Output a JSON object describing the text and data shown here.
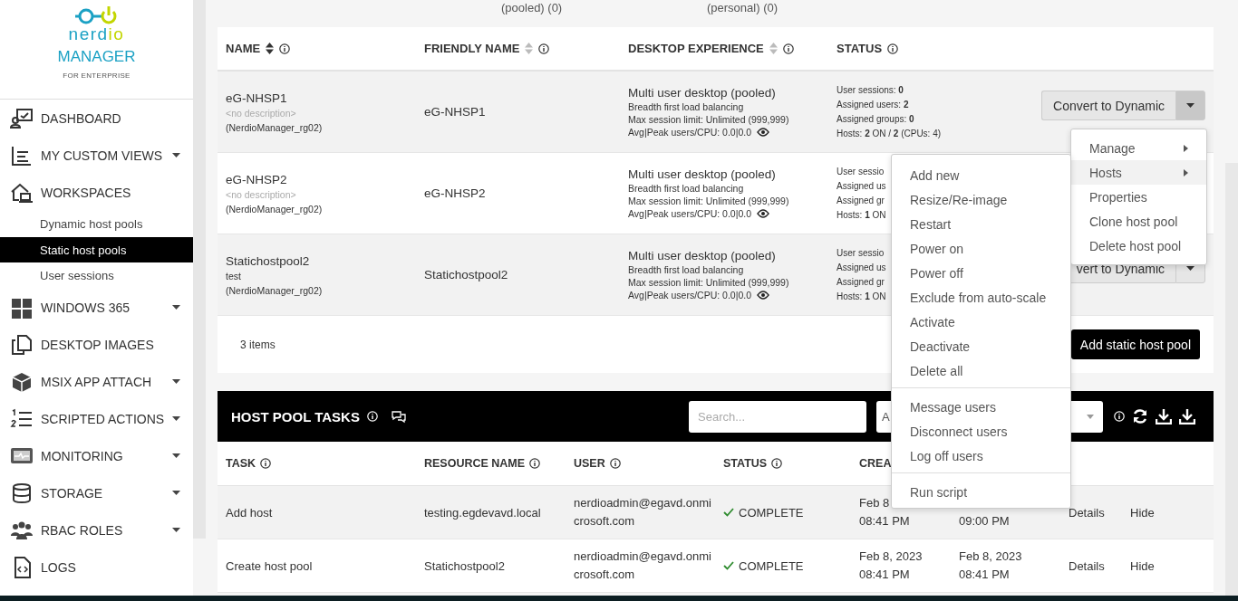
{
  "sidebar": {
    "logo": {
      "brand_left": "nerd",
      "brand_right": "io",
      "product": "MANAGER",
      "edition": "FOR ENTERPRISE"
    },
    "items": [
      {
        "kind": "section",
        "label": "DASHBOARD",
        "expandable": false,
        "selected": false
      },
      {
        "kind": "section",
        "label": "MY CUSTOM VIEWS",
        "expandable": true,
        "selected": false
      },
      {
        "kind": "section",
        "label": "WORKSPACES",
        "expandable": false,
        "selected": false
      },
      {
        "kind": "sub",
        "label": "Dynamic host pools",
        "selected": false
      },
      {
        "kind": "sub",
        "label": "Static host pools",
        "selected": true
      },
      {
        "kind": "sub",
        "label": "User sessions",
        "selected": false
      },
      {
        "kind": "section",
        "label": "WINDOWS 365",
        "expandable": true,
        "selected": false
      },
      {
        "kind": "section",
        "label": "DESKTOP IMAGES",
        "expandable": false,
        "selected": false
      },
      {
        "kind": "section",
        "label": "MSIX APP ATTACH",
        "expandable": true,
        "selected": false
      },
      {
        "kind": "section",
        "label": "SCRIPTED ACTIONS",
        "expandable": true,
        "selected": false
      },
      {
        "kind": "section",
        "label": "MONITORING",
        "expandable": true,
        "selected": false
      },
      {
        "kind": "section",
        "label": "STORAGE",
        "expandable": true,
        "selected": false
      },
      {
        "kind": "section",
        "label": "RBAC ROLES",
        "expandable": true,
        "selected": false
      },
      {
        "kind": "section",
        "label": "LOGS",
        "expandable": false,
        "selected": false
      }
    ]
  },
  "top_strip": [
    "(pooled) (0)",
    "(personal) (0)"
  ],
  "pools_table": {
    "columns": [
      {
        "label": "NAME",
        "sorted": true
      },
      {
        "label": "FRIENDLY NAME",
        "sorted": false
      },
      {
        "label": "DESKTOP EXPERIENCE",
        "sorted": false
      },
      {
        "label": "STATUS"
      }
    ],
    "rows": [
      {
        "name": "eG-NHSP1",
        "description": "<no description>",
        "description_empty": true,
        "resource_group": "(NerdioManager_rg02)",
        "friendly_name": "eG-NHSP1",
        "experience": "Multi user desktop (pooled)",
        "details": [
          "Breadth first load balancing",
          "Max session limit: Unlimited (999,999)",
          "Avg|Peak users/CPU: 0.0|0.0"
        ],
        "status": [
          "User sessions: **0**",
          "Assigned users: **2**",
          "Assigned groups: **0**",
          "Hosts: **2** ON / **2** (CPUs: 4)"
        ],
        "action": "Convert to Dynamic",
        "menu_open": true
      },
      {
        "name": "eG-NHSP2",
        "description": "<no description>",
        "description_empty": true,
        "resource_group": "(NerdioManager_rg02)",
        "friendly_name": "eG-NHSP2",
        "experience": "Multi user desktop (pooled)",
        "details": [
          "Breadth first load balancing",
          "Max session limit: Unlimited (999,999)",
          "Avg|Peak users/CPU: 0.0|0.0"
        ],
        "status": [
          "User sessio",
          "Assigned us",
          "Assigned gr",
          "Hosts: **1** ON"
        ]
      },
      {
        "name": "Statichostpool2",
        "description": "test",
        "description_empty": false,
        "resource_group": "(NerdioManager_rg02)",
        "friendly_name": "Statichostpool2",
        "experience": "Multi user desktop (pooled)",
        "details": [
          "Breadth first load balancing",
          "Max session limit: Unlimited (999,999)",
          "Avg|Peak users/CPU: 0.0|0.0"
        ],
        "status": [
          "User sessio",
          "Assigned us",
          "Assigned gr",
          "Hosts: **1** ON"
        ],
        "action": "vert to Dynamic",
        "menu_open": false
      }
    ],
    "count": "3 items",
    "add_button": "Add static host pool"
  },
  "action_menu": [
    {
      "label": "Manage",
      "submenu": true,
      "selected": false
    },
    {
      "label": "Hosts",
      "submenu": true,
      "selected": true
    },
    {
      "label": "Properties",
      "submenu": false,
      "selected": false
    },
    {
      "label": "Clone host pool",
      "submenu": false,
      "selected": false
    },
    {
      "label": "Delete host pool",
      "submenu": false,
      "selected": false
    }
  ],
  "hosts_menu": [
    [
      "Add new",
      "Resize/Re-image",
      "Restart",
      "Power on",
      "Power off",
      "Exclude from auto-scale",
      "Activate",
      "Deactivate",
      "Delete all"
    ],
    [
      "Message users",
      "Disconnect users",
      "Log off users"
    ],
    [
      "Run script"
    ]
  ],
  "tasks": {
    "title": "HOST POOL TASKS",
    "search": {
      "placeholder": "Search..."
    },
    "filter": {
      "value": "A"
    },
    "columns": [
      "TASK",
      "RESOURCE NAME",
      "USER",
      "STATUS",
      "CREA"
    ],
    "rows": [
      {
        "task": "Add host",
        "resource": "testing.egdevavd.local",
        "user": "nerdioadmin@egavd.onmicrosoft.com",
        "status": "COMPLETE",
        "created": [
          "Feb 8",
          "08:41 PM"
        ],
        "completed": [
          "09:00 PM"
        ],
        "details": "Details",
        "hide": "Hide"
      },
      {
        "task": "Create host pool",
        "resource": "Statichostpool2",
        "user": "nerdioadmin@egavd.onmicrosoft.com",
        "status": "COMPLETE",
        "created": [
          "Feb 8, 2023",
          "08:41 PM"
        ],
        "completed": [
          "Feb 8, 2023",
          "08:41 PM"
        ],
        "details": "Details",
        "hide": "Hide"
      }
    ]
  }
}
